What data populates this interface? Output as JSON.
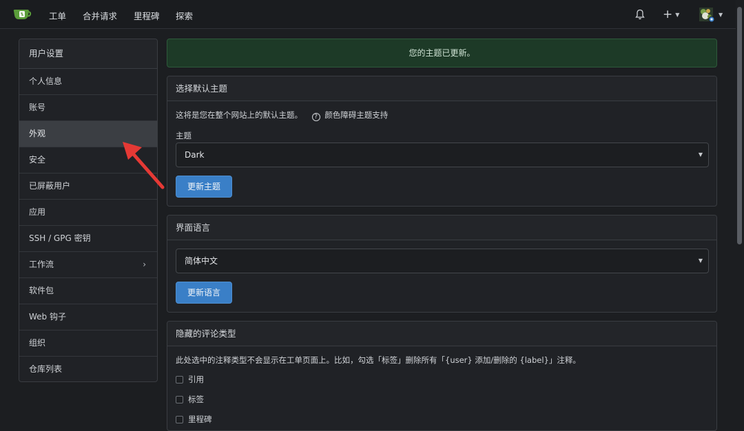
{
  "nav": {
    "items": [
      "工单",
      "合并请求",
      "里程碑",
      "探索"
    ],
    "plus_label": "+"
  },
  "sidebar": {
    "title": "用户设置",
    "items": [
      {
        "label": "个人信息"
      },
      {
        "label": "账号"
      },
      {
        "label": "外观",
        "active": true
      },
      {
        "label": "安全"
      },
      {
        "label": "已屏蔽用户"
      },
      {
        "label": "应用"
      },
      {
        "label": "SSH / GPG 密钥"
      },
      {
        "label": "工作流",
        "has_submenu": true
      },
      {
        "label": "软件包"
      },
      {
        "label": "Web 钩子"
      },
      {
        "label": "组织"
      },
      {
        "label": "仓库列表"
      }
    ]
  },
  "flash": {
    "message": "您的主题已更新。"
  },
  "theme_panel": {
    "title": "选择默认主题",
    "description": "这将是您在整个网站上的默认主题。",
    "help_link": "颜色障碍主题支持",
    "field_label": "主题",
    "selected": "Dark",
    "button": "更新主题"
  },
  "language_panel": {
    "title": "界面语言",
    "selected": "简体中文",
    "button": "更新语言"
  },
  "comment_panel": {
    "title": "隐藏的评论类型",
    "description": "此处选中的注释类型不会显示在工单页面上。比如，勾选「标签」删除所有「{user} 添加/删除的 {label}」注释。",
    "options": [
      "引用",
      "标签",
      "里程碑"
    ]
  },
  "colors": {
    "accent": "#3a7fc7",
    "success_bg": "#1d3a27",
    "annotation_arrow": "#e53935"
  }
}
